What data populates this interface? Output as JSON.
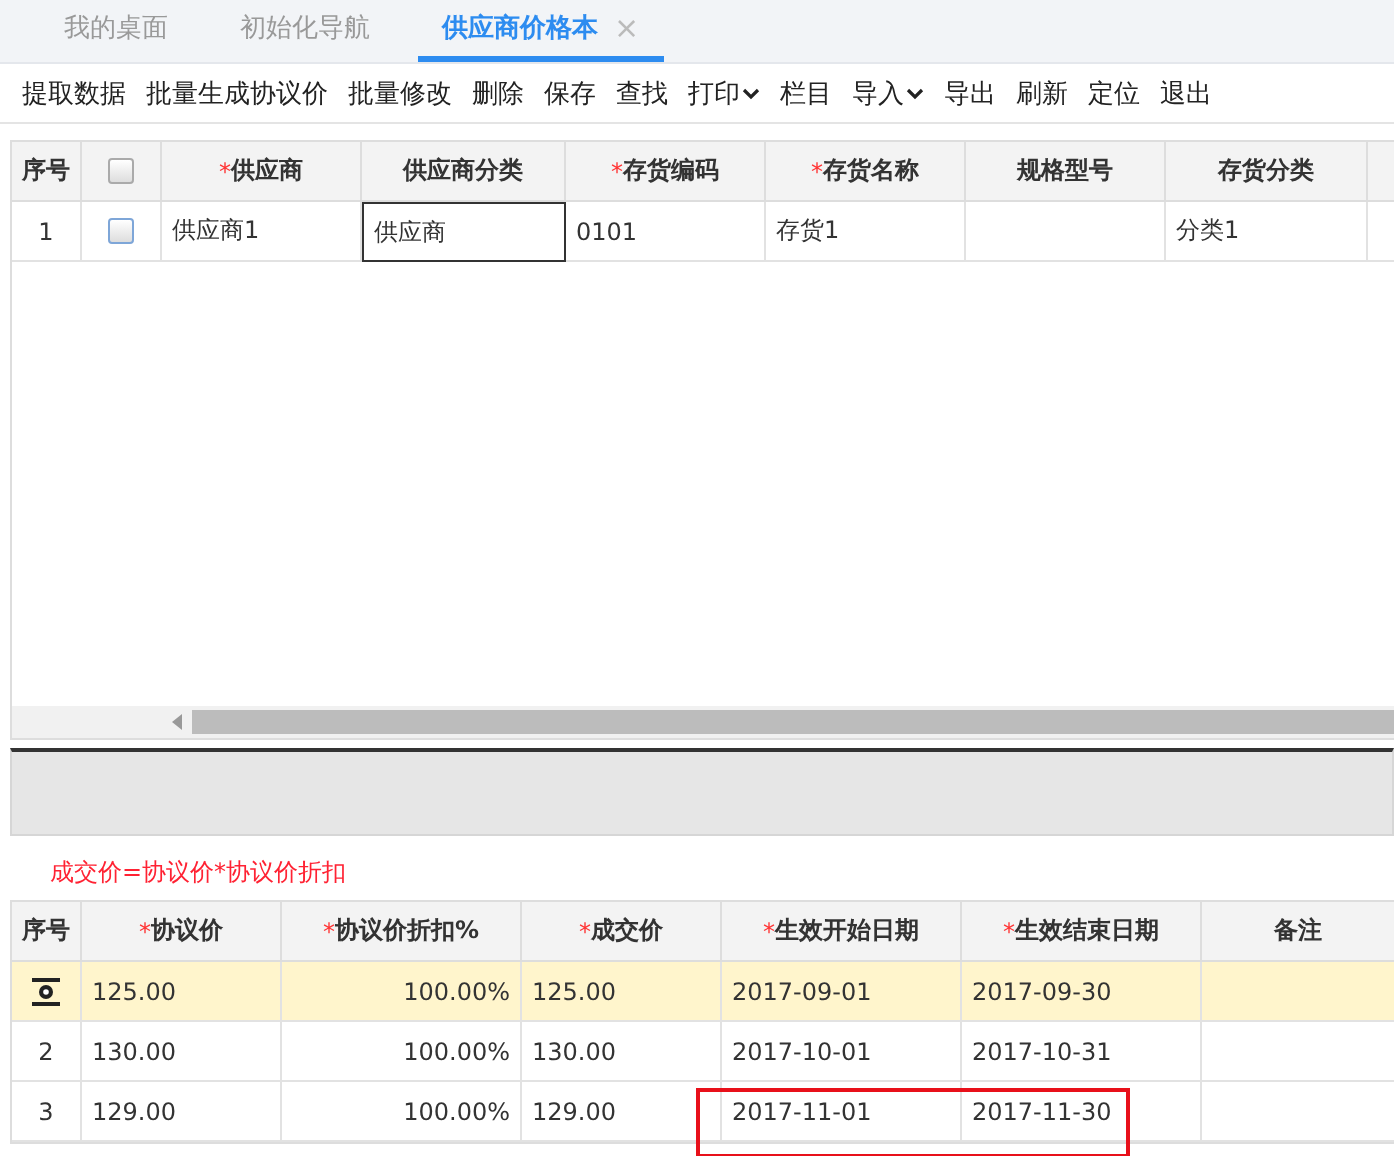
{
  "tabs": [
    {
      "label": "我的桌面",
      "selected": false
    },
    {
      "label": "初始化导航",
      "selected": false
    },
    {
      "label": "供应商价格本",
      "selected": true,
      "close": "×"
    }
  ],
  "toolbar": [
    {
      "label": "提取数据",
      "kind": "plain"
    },
    {
      "label": "批量生成协议价",
      "kind": "plain"
    },
    {
      "label": "批量修改",
      "kind": "plain"
    },
    {
      "label": "删除",
      "kind": "plain"
    },
    {
      "label": "保存",
      "kind": "plain"
    },
    {
      "label": "查找",
      "kind": "plain"
    },
    {
      "label": "打印",
      "kind": "dropdown"
    },
    {
      "label": "栏目",
      "kind": "plain"
    },
    {
      "label": "导入",
      "kind": "dropdown"
    },
    {
      "label": "导出",
      "kind": "plain"
    },
    {
      "label": "刷新",
      "kind": "plain"
    },
    {
      "label": "定位",
      "kind": "plain"
    },
    {
      "label": "退出",
      "kind": "plain"
    }
  ],
  "supplier_table": {
    "columns": [
      {
        "label": "序号"
      },
      {
        "kind": "checkbox",
        "checked": false
      },
      {
        "label": "供应商",
        "required_mark": "*"
      },
      {
        "label": "供应商分类"
      },
      {
        "label": "存货编码",
        "required_mark": "*"
      },
      {
        "label": "存货名称",
        "required_mark": "*"
      },
      {
        "label": "规格型号"
      },
      {
        "label": "存货分类"
      }
    ],
    "rows": [
      {
        "cells": [
          {
            "kind": "text",
            "text": "1",
            "editing": false
          },
          {
            "kind": "checkbox",
            "checked": false
          },
          {
            "kind": "text",
            "text": "供应商1",
            "editing": false
          },
          {
            "kind": "text",
            "text": "供应商",
            "editing": true
          },
          {
            "kind": "text",
            "text": "0101",
            "editing": false
          },
          {
            "kind": "text",
            "text": "存货1",
            "editing": false
          },
          {
            "kind": "text",
            "text": "",
            "editing": false
          },
          {
            "kind": "text",
            "text": "分类1",
            "editing": false
          }
        ]
      }
    ]
  },
  "formula": "成交价=协议价*协议价折扣",
  "price_table": {
    "columns": [
      {
        "label": "序号"
      },
      {
        "label": "协议价",
        "required_mark": "*"
      },
      {
        "label": "协议价折扣%",
        "required_mark": "*"
      },
      {
        "label": "成交价",
        "required_mark": "*"
      },
      {
        "label": "生效开始日期",
        "required_mark": "*"
      },
      {
        "label": "生效结束日期",
        "required_mark": "*"
      },
      {
        "label": "备注"
      }
    ],
    "rows": [
      {
        "selected": true,
        "highlighted": false,
        "cells": [
          "",
          "125.00",
          "100.00%",
          "125.00",
          "2017-09-01",
          "2017-09-30",
          ""
        ]
      },
      {
        "selected": false,
        "highlighted": false,
        "cells": [
          "2",
          "130.00",
          "100.00%",
          "130.00",
          "2017-10-01",
          "2017-10-31",
          ""
        ]
      },
      {
        "selected": false,
        "highlighted": true,
        "cells": [
          "3",
          "129.00",
          "100.00%",
          "129.00",
          "2017-11-01",
          "2017-11-30",
          ""
        ]
      }
    ]
  }
}
